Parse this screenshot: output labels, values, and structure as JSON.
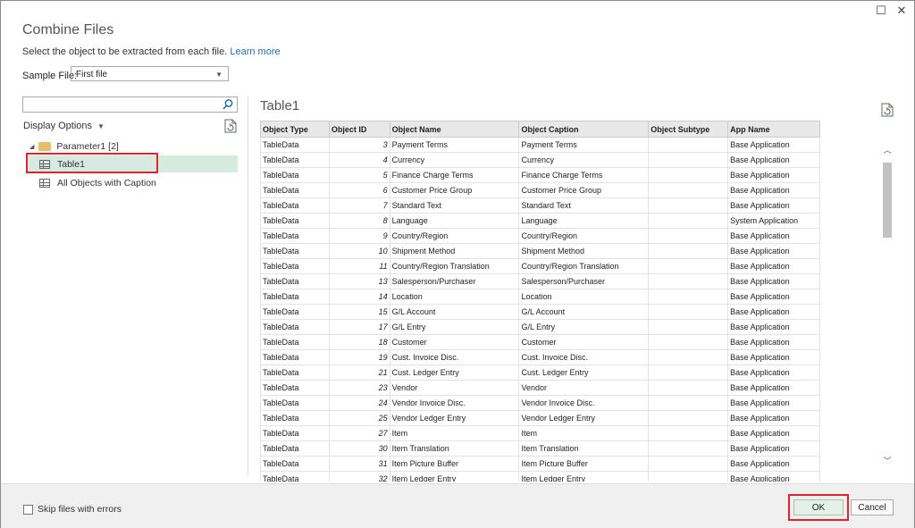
{
  "window": {
    "maximize_glyph": "☐",
    "close_glyph": "✕"
  },
  "header": {
    "title": "Combine Files",
    "subtitle": "Select the object to be extracted from each file.",
    "learn_more": "Learn more"
  },
  "sample_file": {
    "label": "Sample File:",
    "value": "First file"
  },
  "left": {
    "search_placeholder": "",
    "display_options": "Display Options",
    "tree": {
      "parent": "Parameter1 [2]",
      "items": [
        {
          "label": "Table1",
          "selected": true
        },
        {
          "label": "All Objects with Caption",
          "selected": false
        }
      ]
    }
  },
  "preview": {
    "title": "Table1",
    "columns": [
      "Object Type",
      "Object ID",
      "Object Name",
      "Object Caption",
      "Object Subtype",
      "App Name"
    ],
    "rows": [
      [
        "TableData",
        "3",
        "Payment Terms",
        "Payment Terms",
        "",
        "Base Application"
      ],
      [
        "TableData",
        "4",
        "Currency",
        "Currency",
        "",
        "Base Application"
      ],
      [
        "TableData",
        "5",
        "Finance Charge Terms",
        "Finance Charge Terms",
        "",
        "Base Application"
      ],
      [
        "TableData",
        "6",
        "Customer Price Group",
        "Customer Price Group",
        "",
        "Base Application"
      ],
      [
        "TableData",
        "7",
        "Standard Text",
        "Standard Text",
        "",
        "Base Application"
      ],
      [
        "TableData",
        "8",
        "Language",
        "Language",
        "",
        "System Application"
      ],
      [
        "TableData",
        "9",
        "Country/Region",
        "Country/Region",
        "",
        "Base Application"
      ],
      [
        "TableData",
        "10",
        "Shipment Method",
        "Shipment Method",
        "",
        "Base Application"
      ],
      [
        "TableData",
        "11",
        "Country/Region Translation",
        "Country/Region Translation",
        "",
        "Base Application"
      ],
      [
        "TableData",
        "13",
        "Salesperson/Purchaser",
        "Salesperson/Purchaser",
        "",
        "Base Application"
      ],
      [
        "TableData",
        "14",
        "Location",
        "Location",
        "",
        "Base Application"
      ],
      [
        "TableData",
        "15",
        "G/L Account",
        "G/L Account",
        "",
        "Base Application"
      ],
      [
        "TableData",
        "17",
        "G/L Entry",
        "G/L Entry",
        "",
        "Base Application"
      ],
      [
        "TableData",
        "18",
        "Customer",
        "Customer",
        "",
        "Base Application"
      ],
      [
        "TableData",
        "19",
        "Cust. Invoice Disc.",
        "Cust. Invoice Disc.",
        "",
        "Base Application"
      ],
      [
        "TableData",
        "21",
        "Cust. Ledger Entry",
        "Cust. Ledger Entry",
        "",
        "Base Application"
      ],
      [
        "TableData",
        "23",
        "Vendor",
        "Vendor",
        "",
        "Base Application"
      ],
      [
        "TableData",
        "24",
        "Vendor Invoice Disc.",
        "Vendor Invoice Disc.",
        "",
        "Base Application"
      ],
      [
        "TableData",
        "25",
        "Vendor Ledger Entry",
        "Vendor Ledger Entry",
        "",
        "Base Application"
      ],
      [
        "TableData",
        "27",
        "Item",
        "Item",
        "",
        "Base Application"
      ],
      [
        "TableData",
        "30",
        "Item Translation",
        "Item Translation",
        "",
        "Base Application"
      ],
      [
        "TableData",
        "31",
        "Item Picture Buffer",
        "Item Picture Buffer",
        "",
        "Base Application"
      ],
      [
        "TableData",
        "32",
        "Item Ledger Entry",
        "Item Ledger Entry",
        "",
        "Base Application"
      ]
    ]
  },
  "footer": {
    "skip_label": "Skip files with errors",
    "skip_checked": false,
    "ok_label": "OK",
    "cancel_label": "Cancel"
  },
  "colors": {
    "highlight_box": "#e0232c",
    "selected_row": "#d6eadf",
    "link": "#1f6fb2"
  }
}
